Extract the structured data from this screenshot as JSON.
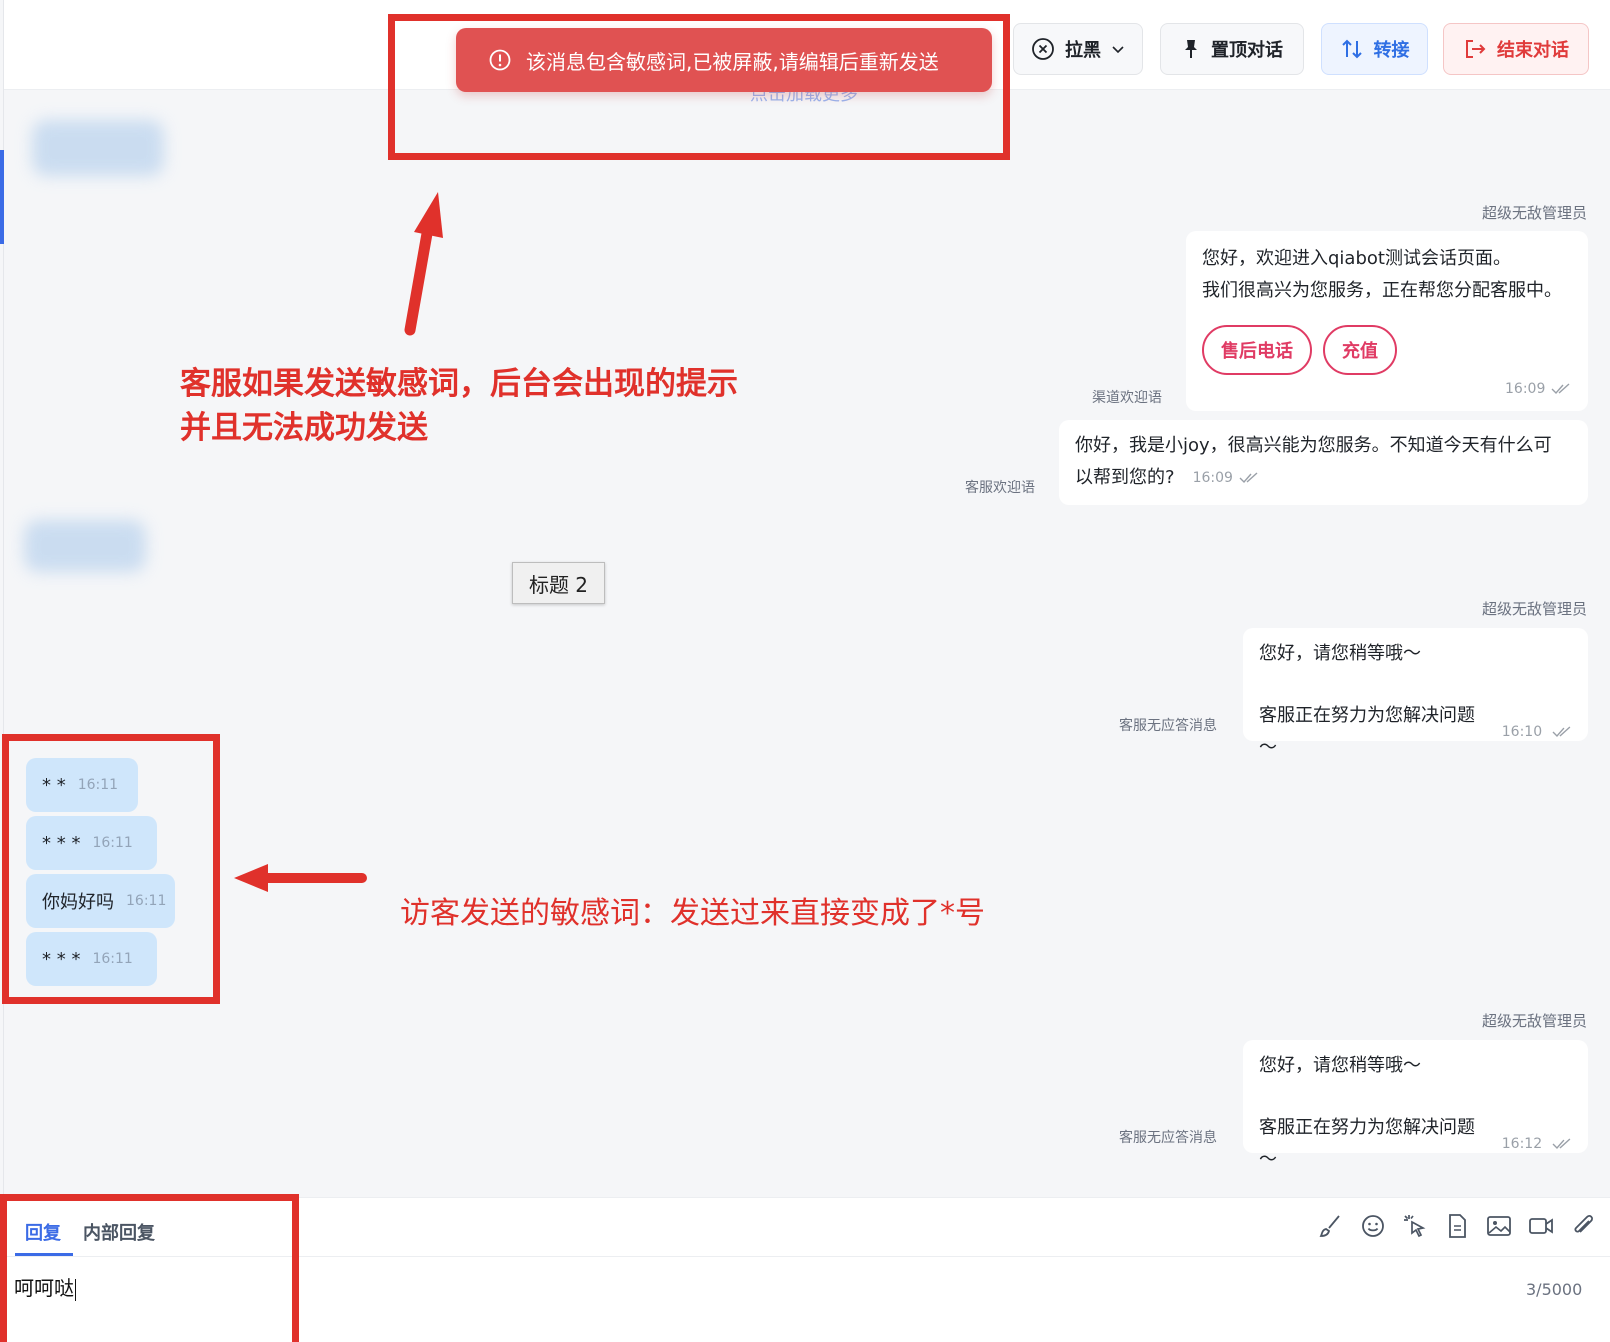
{
  "header": {
    "block_label": "拉黑",
    "pin_label": "置顶对话",
    "transfer_label": "转接",
    "end_label": "结束对话"
  },
  "toast": {
    "message": "该消息包含敏感词,已被屏蔽,请编辑后重新发送"
  },
  "load_more": "点击加载更多",
  "annotations": {
    "agent_note_line1": "客服如果发送敏感词，后台会出现的提示",
    "agent_note_line2": "并且无法成功发送",
    "visitor_note": "访客发送的敏感词：发送过来直接变成了*号"
  },
  "messages": {
    "welcome": {
      "author": "超级无敌管理员",
      "line1": "您好，欢迎进入qiabot测试会话页面。",
      "line2": "我们很高兴为您服务，正在帮您分配客服中。",
      "button1": "售后电话",
      "button2": "充值",
      "time": "16:09",
      "caption": "渠道欢迎语"
    },
    "agent_welcome": {
      "text_line1": "你好，我是小joy，很高兴能为您服务。不知道今天有什么可",
      "text_line2": "以帮到您的?",
      "time": "16:09",
      "caption": "客服欢迎语"
    },
    "heading_tag": "标题 2",
    "no_reply_1": {
      "author": "超级无敌管理员",
      "line1": "您好，请您稍等哦～",
      "line2": "客服正在努力为您解决问题～",
      "time": "16:10",
      "caption": "客服无应答消息"
    },
    "visitor": [
      {
        "text": "* *",
        "time": "16:11"
      },
      {
        "text": "* * *",
        "time": "16:11"
      },
      {
        "text": "你妈好吗",
        "time": "16:11"
      },
      {
        "text": "* * *",
        "time": "16:11"
      }
    ],
    "no_reply_2": {
      "author": "超级无敌管理员",
      "line1": "您好，请您稍等哦～",
      "line2": "客服正在努力为您解决问题～",
      "time": "16:12",
      "caption": "客服无应答消息"
    }
  },
  "composer": {
    "tab_reply": "回复",
    "tab_internal": "内部回复",
    "input_value": "呵呵哒",
    "counter": "3/5000",
    "tools": [
      "brush-icon",
      "emoji-icon",
      "pointer-icon",
      "document-icon",
      "image-icon",
      "video-icon",
      "attachment-icon"
    ]
  },
  "colors": {
    "annotation_red": "#e0312b",
    "toast_red": "#e05252",
    "accent_blue": "#3b6be6",
    "visitor_bubble": "#cfe6fb"
  }
}
